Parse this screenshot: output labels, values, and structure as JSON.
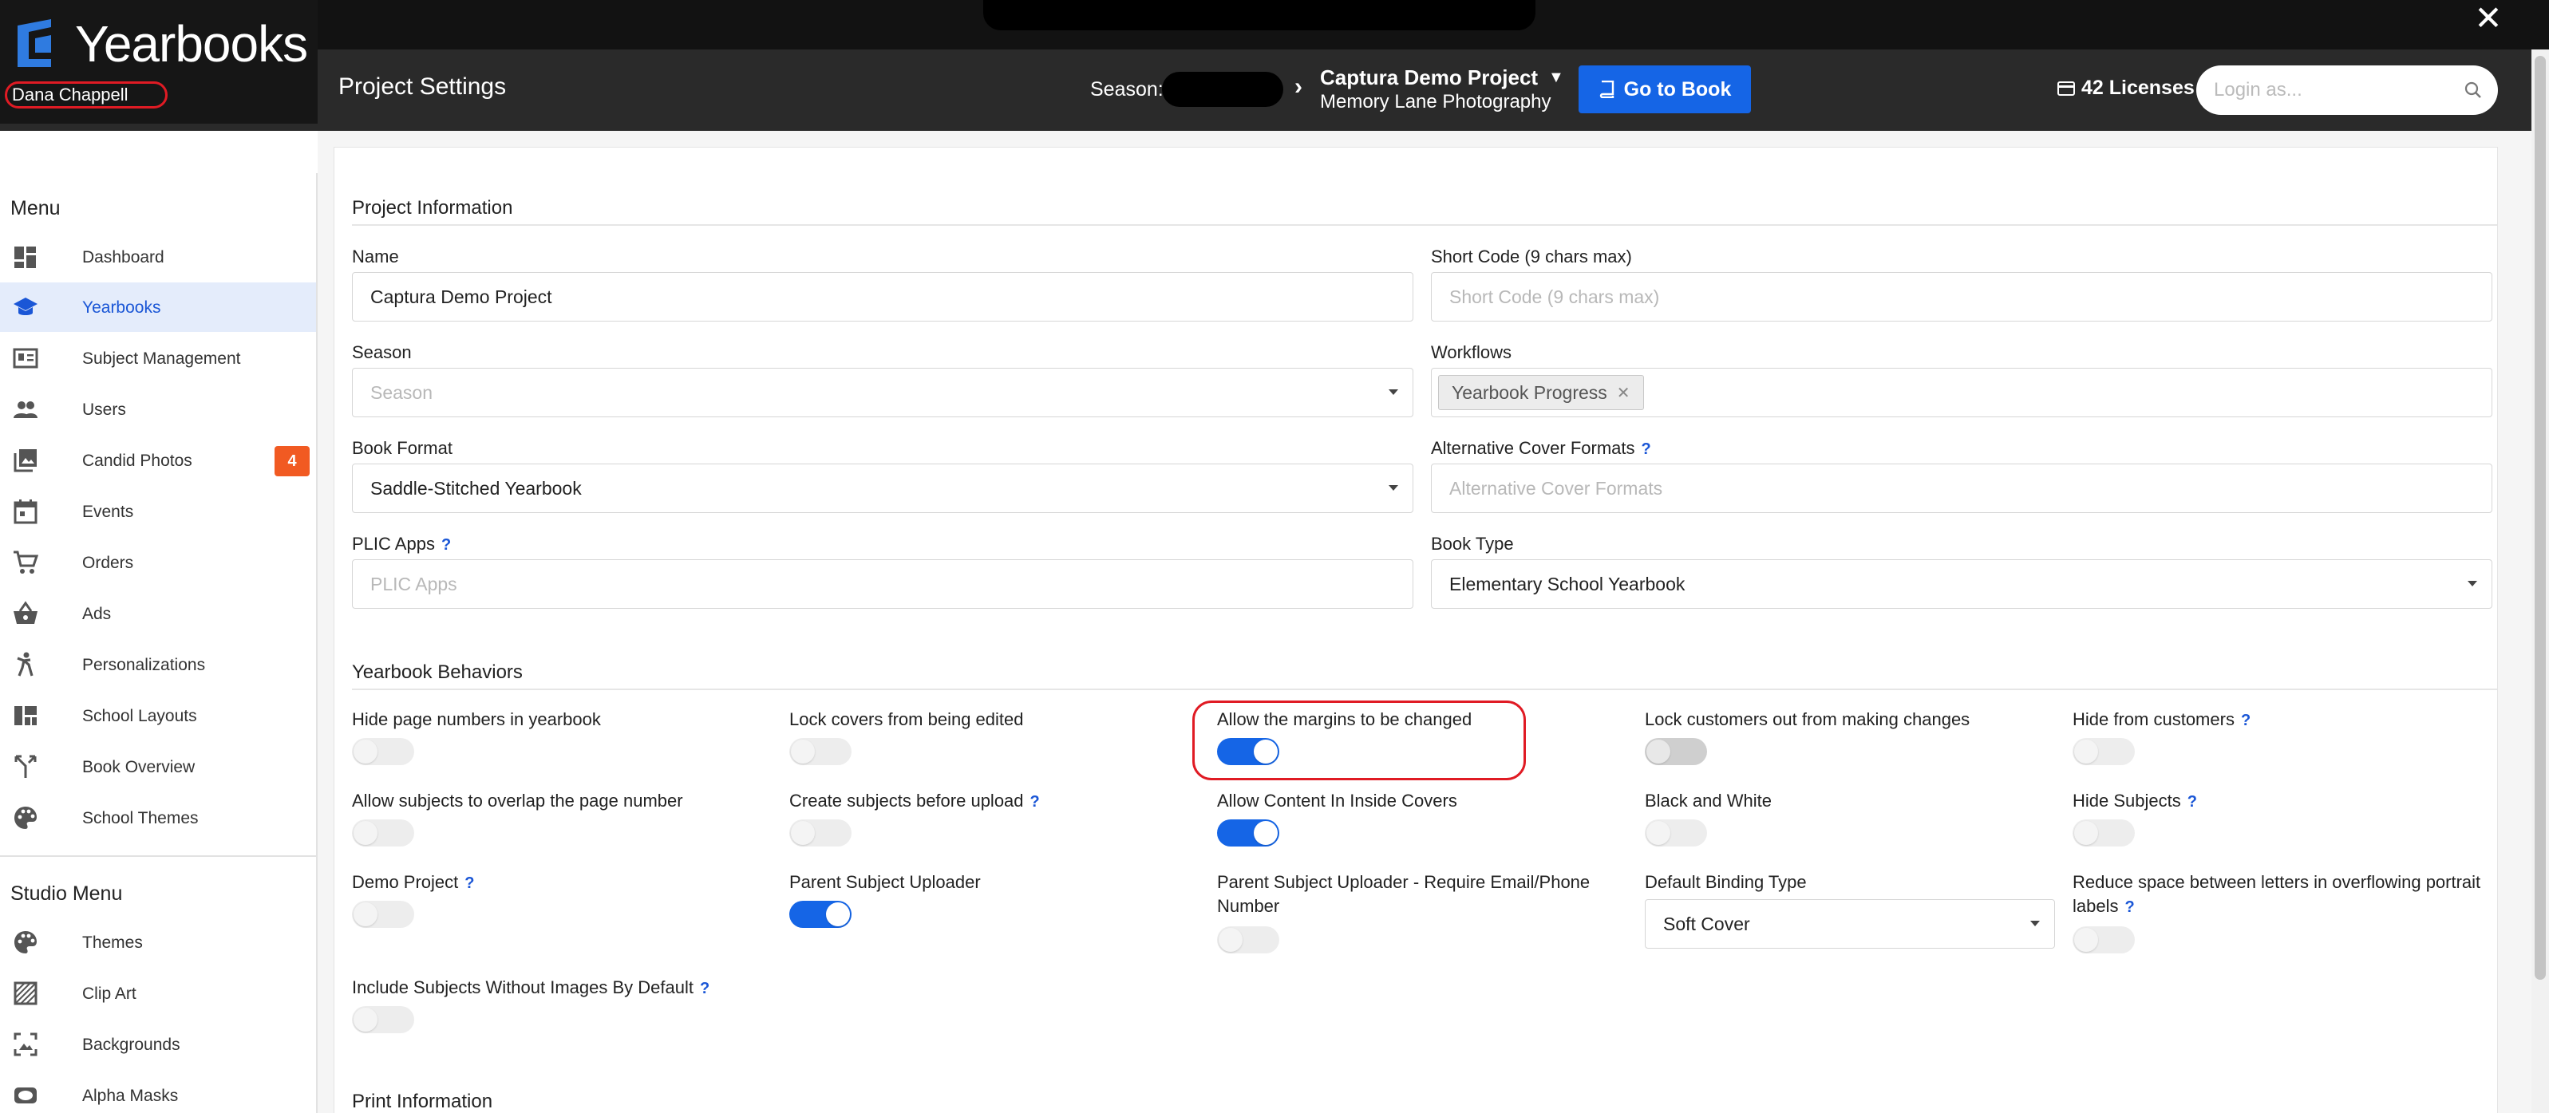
{
  "app": {
    "brand": "Yearbooks",
    "user": "Dana Chappell",
    "page_title": "Project Settings"
  },
  "header": {
    "season_label": "Season:",
    "project_name": "Captura Demo Project",
    "studio_name": "Memory Lane Photography",
    "goto_book_label": "Go to Book",
    "licenses_label": "42 Licenses",
    "login_placeholder": "Login as..."
  },
  "sidebar": {
    "menu_title": "Menu",
    "items": [
      {
        "label": "Dashboard",
        "icon": "dashboard-icon"
      },
      {
        "label": "Yearbooks",
        "icon": "graduation-cap-icon",
        "active": true
      },
      {
        "label": "Subject Management",
        "icon": "id-card-icon"
      },
      {
        "label": "Users",
        "icon": "users-icon"
      },
      {
        "label": "Candid Photos",
        "icon": "photo-library-icon",
        "badge": "4"
      },
      {
        "label": "Events",
        "icon": "calendar-icon"
      },
      {
        "label": "Orders",
        "icon": "cart-icon"
      },
      {
        "label": "Ads",
        "icon": "basket-icon"
      },
      {
        "label": "Personalizations",
        "icon": "person-pose-icon"
      },
      {
        "label": "School Layouts",
        "icon": "layout-icon"
      },
      {
        "label": "Book Overview",
        "icon": "fork-icon"
      },
      {
        "label": "School Themes",
        "icon": "palette-icon"
      }
    ],
    "studio_title": "Studio Menu",
    "studio_items": [
      {
        "label": "Themes",
        "icon": "palette-icon"
      },
      {
        "label": "Clip Art",
        "icon": "clip-art-icon"
      },
      {
        "label": "Backgrounds",
        "icon": "background-icon"
      },
      {
        "label": "Alpha Masks",
        "icon": "mask-icon"
      }
    ]
  },
  "project_info": {
    "section_title": "Project Information",
    "name_label": "Name",
    "name_value": "Captura Demo Project",
    "short_code_label": "Short Code (9 chars max)",
    "short_code_placeholder": "Short Code (9 chars max)",
    "season_label": "Season",
    "season_placeholder": "Season",
    "workflows_label": "Workflows",
    "workflow_tag": "Yearbook Progress",
    "book_format_label": "Book Format",
    "book_format_value": "Saddle-Stitched Yearbook",
    "alt_cover_label": "Alternative Cover Formats",
    "alt_cover_placeholder": "Alternative Cover Formats",
    "plic_label": "PLIC Apps",
    "plic_placeholder": "PLIC Apps",
    "book_type_label": "Book Type",
    "book_type_value": "Elementary School Yearbook",
    "help_mark": "?"
  },
  "behaviors": {
    "section_title": "Yearbook Behaviors",
    "hide_page_numbers": "Hide page numbers in yearbook",
    "lock_covers": "Lock covers from being edited",
    "allow_margins": "Allow the margins to be changed",
    "lock_customers": "Lock customers out from making changes",
    "hide_from_customers": "Hide from customers",
    "allow_overlap": "Allow subjects to overlap the page number",
    "create_subjects": "Create subjects before upload",
    "allow_content_inside": "Allow Content In Inside Covers",
    "black_white": "Black and White",
    "hide_subjects": "Hide Subjects",
    "demo_project": "Demo Project",
    "parent_uploader": "Parent Subject Uploader",
    "parent_uploader_require_line1": "Parent Subject Uploader - Require Email/Phone",
    "parent_uploader_require_line2": "Number",
    "default_binding_label": "Default Binding Type",
    "default_binding_value": "Soft Cover",
    "reduce_space_line1": "Reduce space between letters in overflowing portrait",
    "reduce_space_line2": "labels",
    "include_subjects": "Include Subjects Without Images By Default"
  },
  "print_info": {
    "section_title": "Print Information"
  },
  "colors": {
    "accent": "#1565e6",
    "badge": "#f15a22",
    "highlight": "#e01b24"
  }
}
